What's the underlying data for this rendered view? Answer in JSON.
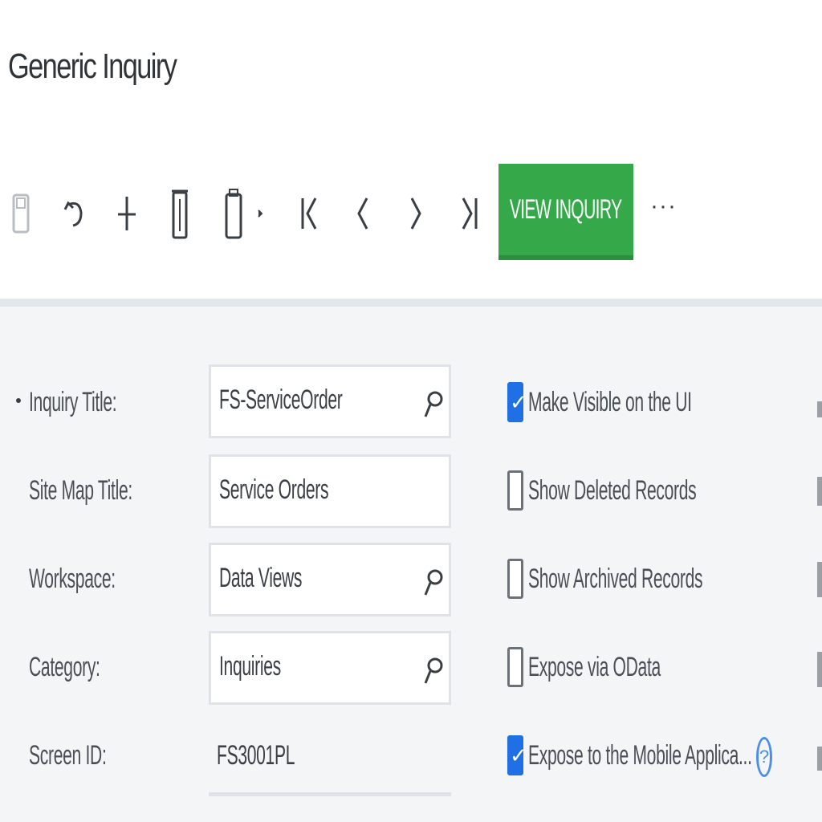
{
  "page": {
    "title": "Generic Inquiry"
  },
  "toolbar": {
    "view_inquiry_label": "VIEW INQUIRY",
    "more_label": "···",
    "icons": [
      "save-icon",
      "undo-icon",
      "add-icon",
      "delete-icon",
      "copy-paste-icon",
      "first-record-icon",
      "previous-record-icon",
      "next-record-icon",
      "last-record-icon"
    ]
  },
  "form": {
    "inquiry_title": {
      "label": "Inquiry Title:",
      "value": "FS-ServiceOrder",
      "required": true
    },
    "site_map_title": {
      "label": "Site Map Title:",
      "value": "Service Orders"
    },
    "workspace": {
      "label": "Workspace:",
      "value": "Data Views"
    },
    "category": {
      "label": "Category:",
      "value": "Inquiries"
    },
    "screen_id": {
      "label": "Screen ID:",
      "value": "FS3001PL"
    }
  },
  "options": [
    {
      "label": "Make Visible on the UI",
      "checked": true
    },
    {
      "label": "Show Deleted Records",
      "checked": false
    },
    {
      "label": "Show Archived Records",
      "checked": false
    },
    {
      "label": "Expose via OData",
      "checked": false
    },
    {
      "label": "Expose to the Mobile Applica...",
      "checked": true
    }
  ],
  "colors": {
    "accent_green": "#35a94a",
    "checkbox_blue": "#1f6fe5"
  }
}
